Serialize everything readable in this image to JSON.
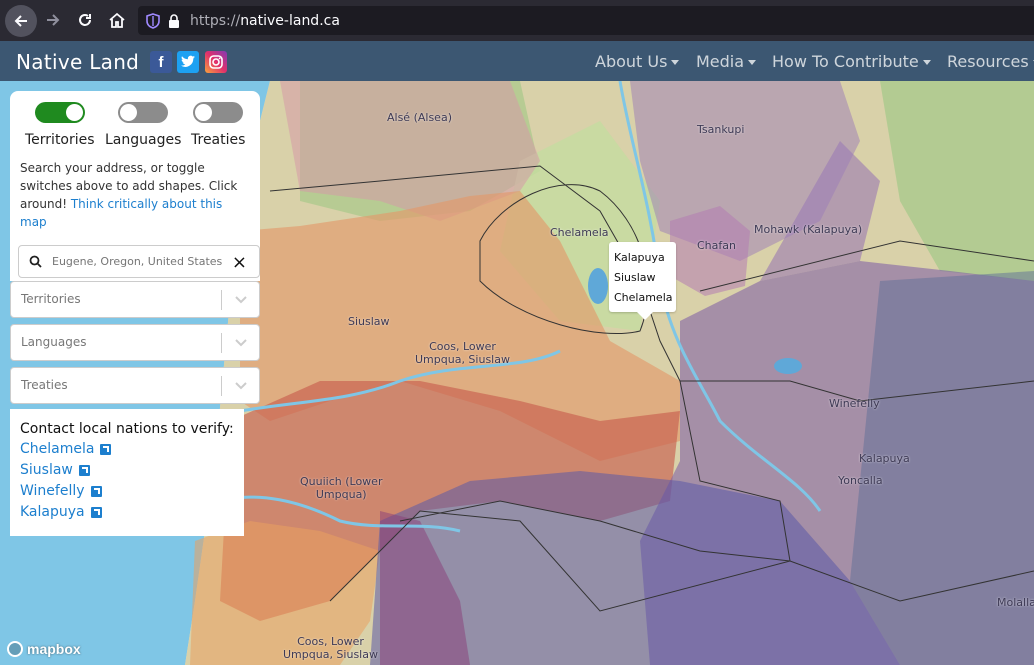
{
  "browser": {
    "url_scheme": "https://",
    "url_host": "native-land.ca"
  },
  "site": {
    "brand": "Native Land",
    "social": [
      "f",
      "t",
      "ig"
    ],
    "menu": [
      "About Us",
      "Media",
      "How To Contribute",
      "Resources"
    ]
  },
  "panel": {
    "toggles": [
      {
        "label": "Territories",
        "on": true
      },
      {
        "label": "Languages",
        "on": false
      },
      {
        "label": "Treaties",
        "on": false
      }
    ],
    "hint_text": "Search your address, or toggle switches above to add shapes. Click around!",
    "hint_link": "Think critically about this map",
    "search_placeholder": "Eugene, Oregon, United States",
    "search_clear": "×",
    "dropdowns": [
      "Territories",
      "Languages",
      "Treaties"
    ],
    "contact_title": "Contact local nations to verify:",
    "contact_links": [
      "Chelamela",
      "Siuslaw",
      "Winefelly",
      "Kalapuya"
    ]
  },
  "map": {
    "popup_lines": [
      "Kalapuya",
      "Siuslaw",
      "Chelamela"
    ],
    "labels": {
      "alse": "Alsé (Alsea)",
      "tsankupi": "Tsankupi",
      "chelamela": "Chelamela",
      "chafan": "Chafan",
      "mohawk": "Mohawk (Kalapuya)",
      "siuslaw": "Siuslaw",
      "coos1_a": "Coos, Lower",
      "coos1_b": "Umpqua, Siuslaw",
      "winefelly": "Winefelly",
      "kalapuya": "Kalapuya",
      "yoncalla": "Yoncalla",
      "quuiich_a": "Quuiich (Lower",
      "quuiich_b": "Umpqua)",
      "coos2_a": "Coos, Lower",
      "coos2_b": "Umpqua, Siuslaw",
      "molalla": "Molalla"
    },
    "attribution": "mapbox"
  },
  "colors": {
    "navbar": "#3c5772",
    "toggle_on": "#1f8a1f",
    "link": "#1d7fce",
    "ocean": "#7fc6e6"
  }
}
